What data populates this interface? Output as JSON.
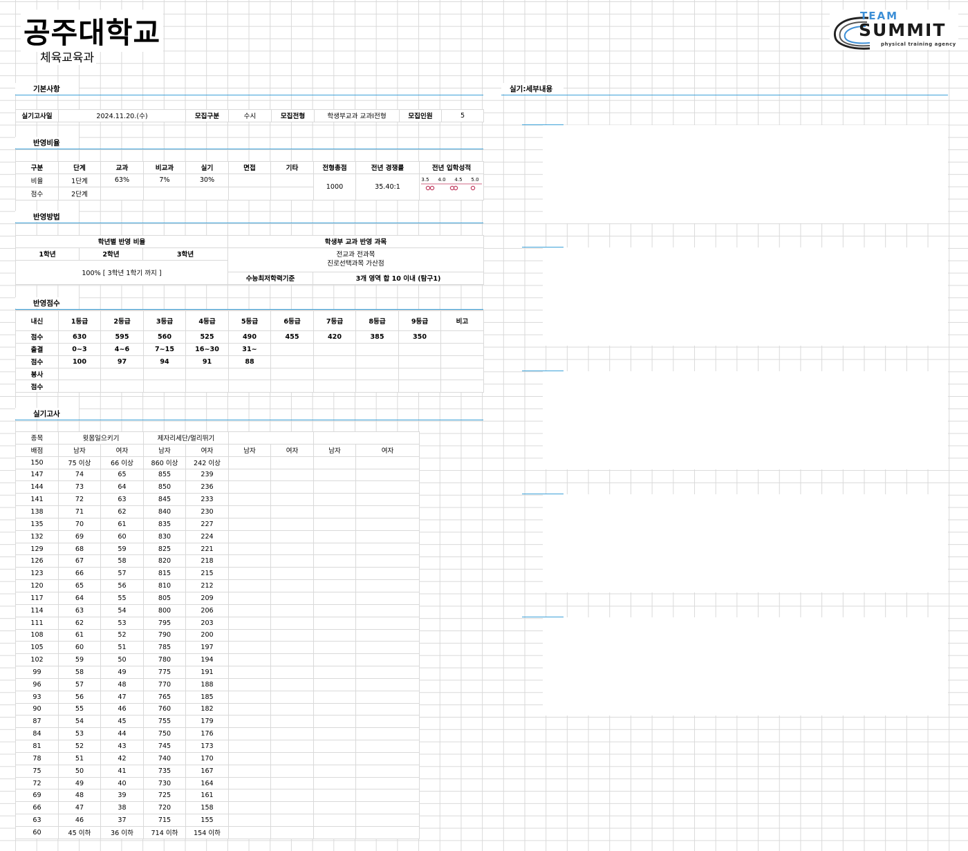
{
  "header": {
    "school": "공주대학교",
    "department": "체육교육과"
  },
  "logo": {
    "team": "TEAM",
    "summit": "SUMMIT",
    "agency": "physical training agency"
  },
  "basic": {
    "section_title": "기본사항",
    "exam_date_label": "실기고사일",
    "exam_date": "2024.11.20.(수)",
    "category_label": "모집구분",
    "category": "수시",
    "type_label": "모집전형",
    "type": "학생부교과 교과Ⅰ전형",
    "quota_label": "모집인원",
    "quota": "5"
  },
  "ratio": {
    "section_title": "반영비율",
    "headers": [
      "구분",
      "단계",
      "교과",
      "비교과",
      "실기",
      "면접",
      "기타",
      "전형총점",
      "전년 경쟁률",
      "전년 입학성적"
    ],
    "row1": {
      "label": "비율",
      "stage": "1단계",
      "subject": "63%",
      "nonsubject": "7%",
      "practical": "30%"
    },
    "row2": {
      "label": "점수",
      "stage": "2단계"
    },
    "total": "1000",
    "competition": "35.40:1",
    "admission_scale": [
      "3.5",
      "4.0",
      "4.5",
      "5.0"
    ],
    "admission_marker_color": "#c0395e"
  },
  "method": {
    "section_title": "반영방법",
    "grade_ratio_title": "학년별 반영 비율",
    "grades": [
      "1학년",
      "2학년",
      "3학년"
    ],
    "grade_ratio_value": "100% [ 3학년 1학기 까지 ]",
    "subjects_title": "학생부 교과 반영 과목",
    "subjects_line1": "전교과 전과목",
    "subjects_line2": "진로선택과목 가산점",
    "csat_label": "수능최저학력기준",
    "csat_value": "3개 영역 합 10 이내 (탐구1)"
  },
  "score": {
    "section_title": "반영점수",
    "header_label": "내신",
    "grades": [
      "1등급",
      "2등급",
      "3등급",
      "4등급",
      "5등급",
      "6등급",
      "7등급",
      "8등급",
      "9등급",
      "비고"
    ],
    "grade_points_label": "점수",
    "grade_points": [
      "630",
      "595",
      "560",
      "525",
      "490",
      "455",
      "420",
      "385",
      "350"
    ],
    "attendance_label": "출결",
    "attendance": [
      "0~3",
      "4~6",
      "7~15",
      "16~30",
      "31~"
    ],
    "attendance_points_label": "점수",
    "attendance_points": [
      "100",
      "97",
      "94",
      "91",
      "88"
    ],
    "volunteer_label": "봉사",
    "volunteer_points_label": "점수"
  },
  "practical": {
    "section_title": "실기고사",
    "event_label": "종목",
    "event1": "윗몸일으키기",
    "event2": "제자리세단/멀리뛰기",
    "score_label": "배점",
    "male": "남자",
    "female": "여자",
    "rows": [
      [
        "150",
        "75 이상",
        "66 이상",
        "860 이상",
        "242 이상"
      ],
      [
        "147",
        "74",
        "65",
        "855",
        "239"
      ],
      [
        "144",
        "73",
        "64",
        "850",
        "236"
      ],
      [
        "141",
        "72",
        "63",
        "845",
        "233"
      ],
      [
        "138",
        "71",
        "62",
        "840",
        "230"
      ],
      [
        "135",
        "70",
        "61",
        "835",
        "227"
      ],
      [
        "132",
        "69",
        "60",
        "830",
        "224"
      ],
      [
        "129",
        "68",
        "59",
        "825",
        "221"
      ],
      [
        "126",
        "67",
        "58",
        "820",
        "218"
      ],
      [
        "123",
        "66",
        "57",
        "815",
        "215"
      ],
      [
        "120",
        "65",
        "56",
        "810",
        "212"
      ],
      [
        "117",
        "64",
        "55",
        "805",
        "209"
      ],
      [
        "114",
        "63",
        "54",
        "800",
        "206"
      ],
      [
        "111",
        "62",
        "53",
        "795",
        "203"
      ],
      [
        "108",
        "61",
        "52",
        "790",
        "200"
      ],
      [
        "105",
        "60",
        "51",
        "785",
        "197"
      ],
      [
        "102",
        "59",
        "50",
        "780",
        "194"
      ],
      [
        "99",
        "58",
        "49",
        "775",
        "191"
      ],
      [
        "96",
        "57",
        "48",
        "770",
        "188"
      ],
      [
        "93",
        "56",
        "47",
        "765",
        "185"
      ],
      [
        "90",
        "55",
        "46",
        "760",
        "182"
      ],
      [
        "87",
        "54",
        "45",
        "755",
        "179"
      ],
      [
        "84",
        "53",
        "44",
        "750",
        "176"
      ],
      [
        "81",
        "52",
        "43",
        "745",
        "173"
      ],
      [
        "78",
        "51",
        "42",
        "740",
        "170"
      ],
      [
        "75",
        "50",
        "41",
        "735",
        "167"
      ],
      [
        "72",
        "49",
        "40",
        "730",
        "164"
      ],
      [
        "69",
        "48",
        "39",
        "725",
        "161"
      ],
      [
        "66",
        "47",
        "38",
        "720",
        "158"
      ],
      [
        "63",
        "46",
        "37",
        "715",
        "155"
      ],
      [
        "60",
        "45 이하",
        "36 이하",
        "714 이하",
        "154 이하"
      ]
    ]
  },
  "detail": {
    "section_title": "실기:세부내용"
  }
}
